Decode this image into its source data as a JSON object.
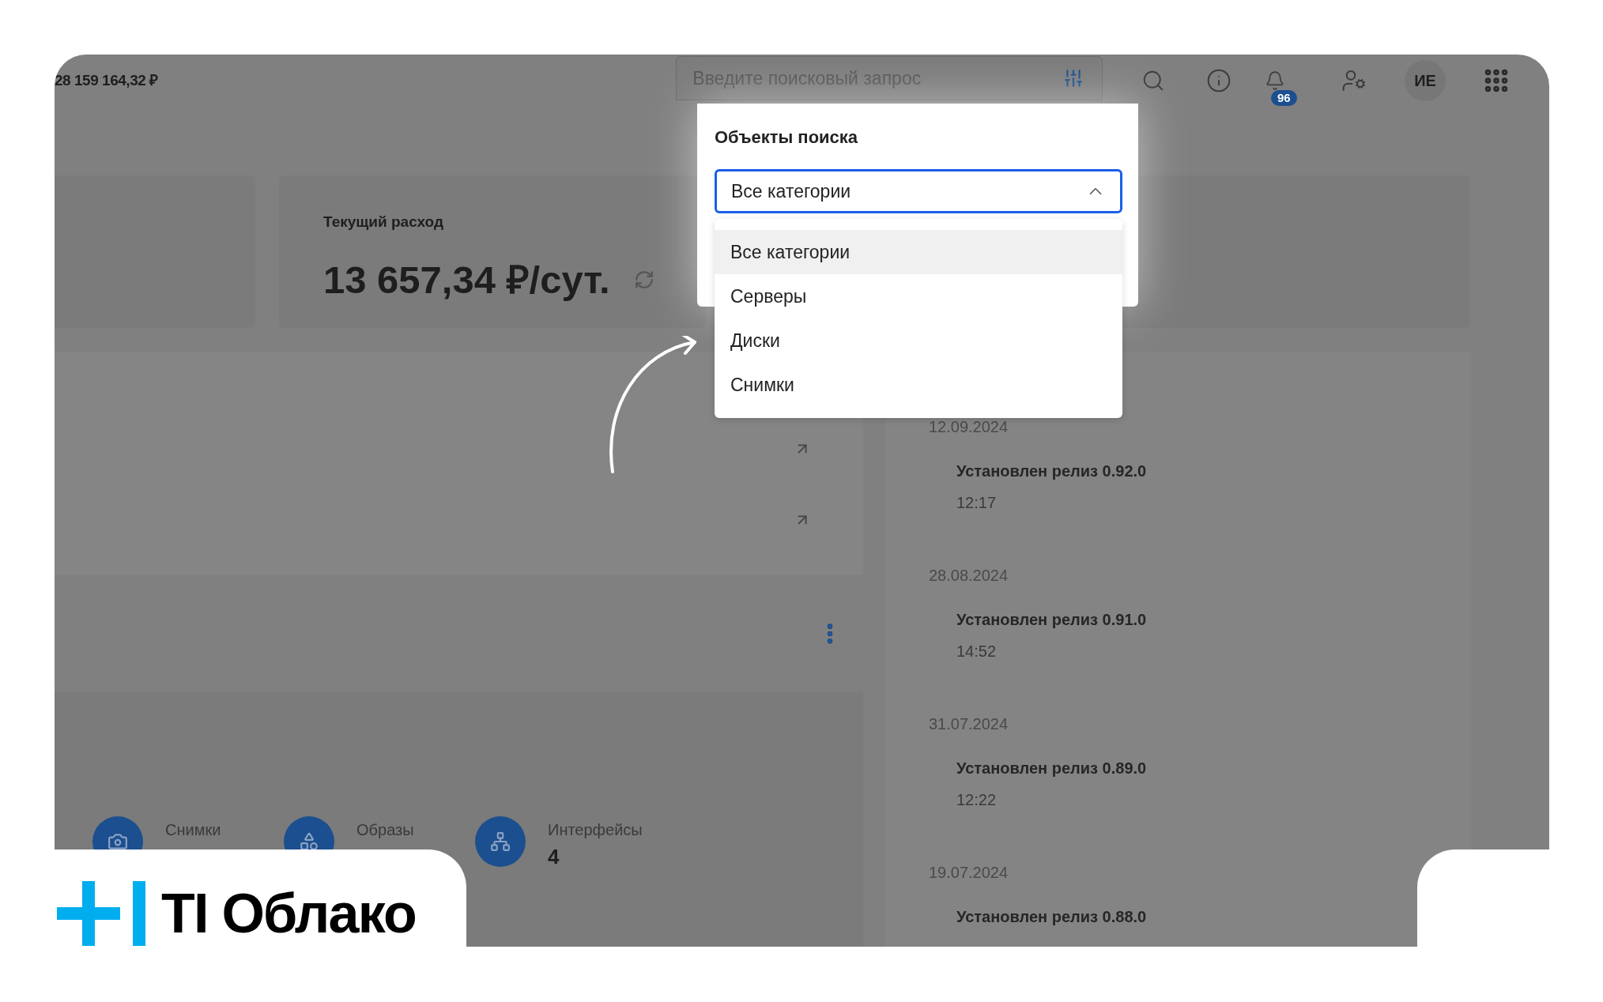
{
  "balance": "28 159 164,32 ₽",
  "search": {
    "placeholder": "Введите поисковый запрос"
  },
  "notifications": {
    "count": "96"
  },
  "avatar": {
    "initials": "ИЕ"
  },
  "expense": {
    "label": "Текущий расход",
    "value": "13 657,34 ₽/сут."
  },
  "search_popover": {
    "title": "Объекты поиска",
    "select": {
      "value": "Все категории",
      "expanded": true
    },
    "options": [
      {
        "label": "Все категории",
        "selected": true
      },
      {
        "label": "Серверы",
        "selected": false
      },
      {
        "label": "Диски",
        "selected": false
      },
      {
        "label": "Снимки",
        "selected": false
      }
    ]
  },
  "resources": [
    {
      "kind": "snapshots",
      "label": "Снимки"
    },
    {
      "kind": "images",
      "label": "Образы"
    },
    {
      "kind": "interfaces",
      "label": "Интерфейсы",
      "count": "4"
    }
  ],
  "releases": [
    {
      "date": "12.09.2024",
      "title": "Установлен релиз 0.92.0",
      "time": "12:17"
    },
    {
      "date": "28.08.2024",
      "title": "Установлен релиз 0.91.0",
      "time": "14:52"
    },
    {
      "date": "31.07.2024",
      "title": "Установлен релиз 0.89.0",
      "time": "12:22"
    },
    {
      "date": "19.07.2024",
      "title": "Установлен релиз 0.88.0"
    }
  ],
  "brand": {
    "name": "TI Облако"
  }
}
